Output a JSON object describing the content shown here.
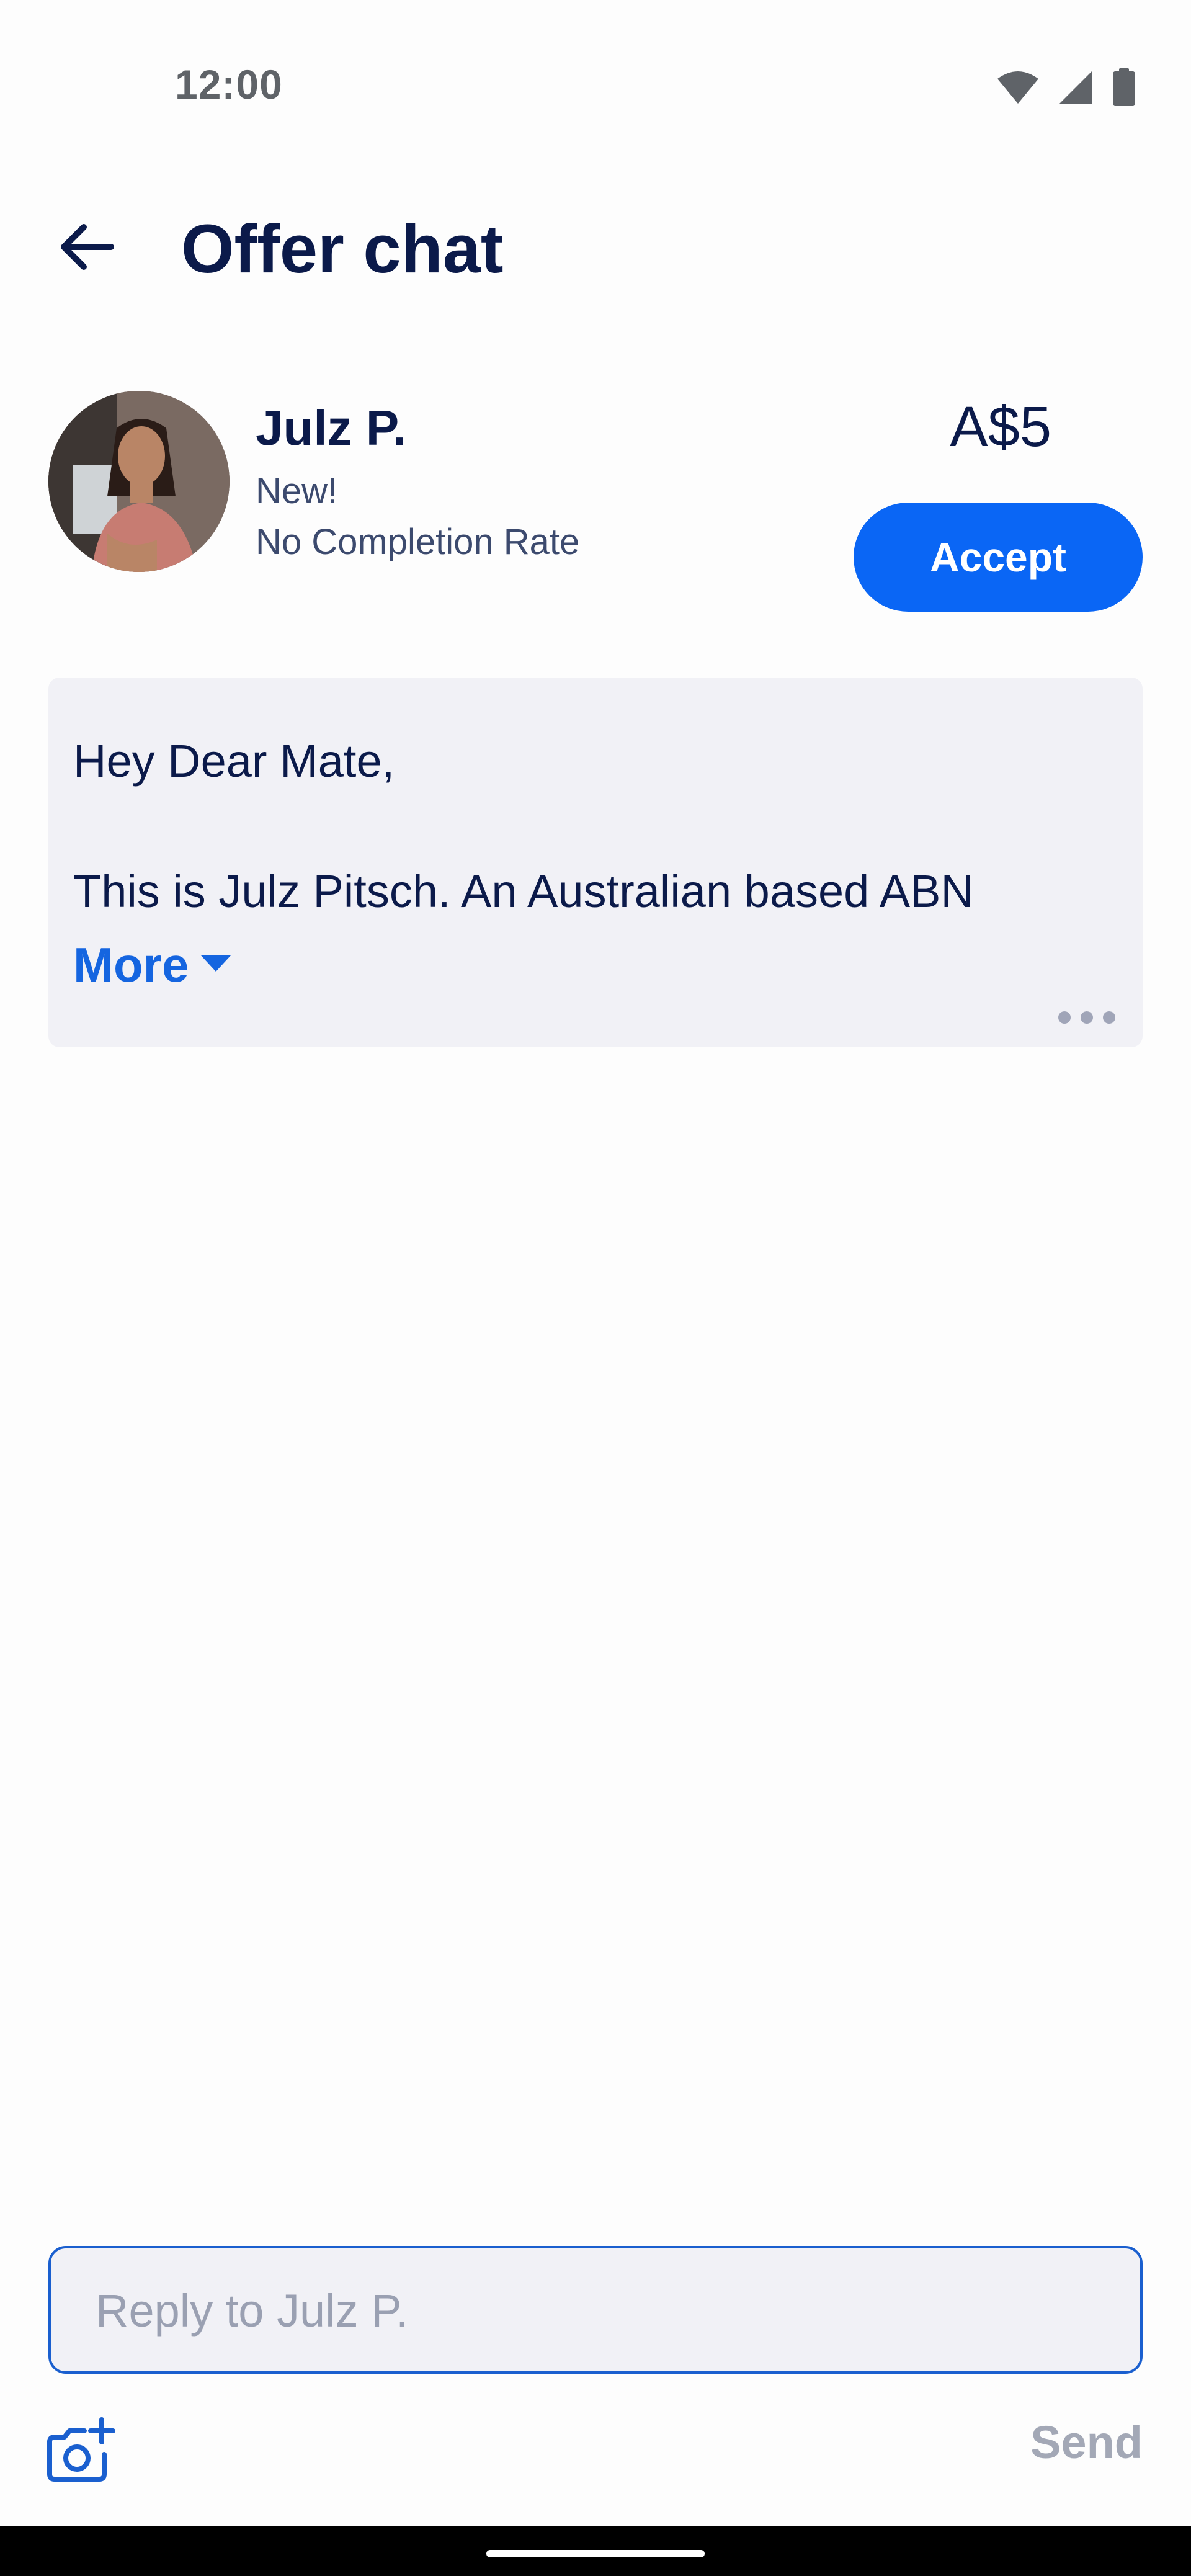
{
  "status_bar": {
    "time": "12:00",
    "icons": [
      "wifi-icon",
      "cellular-signal-icon",
      "battery-icon"
    ]
  },
  "app_bar": {
    "back_icon": "arrow-left-icon",
    "title": "Offer chat"
  },
  "offer": {
    "user_name": "Julz P.",
    "badge": "New!",
    "completion_rate": "No Completion Rate",
    "price": "A$5",
    "accept_label": "Accept"
  },
  "message": {
    "greeting": "Hey Dear Mate,",
    "body_preview": "This is Julz Pitsch. An Australian based ABN",
    "more_label": "More",
    "more_icon": "caret-down-icon",
    "options_icon": "more-horizontal-icon"
  },
  "reply": {
    "placeholder": "Reply to Julz P.",
    "value": "",
    "attach_icon": "add-photo-camera-icon",
    "send_label": "Send"
  },
  "colors": {
    "primary": "#0a66f5",
    "link": "#1565e0",
    "title_text": "#0b1a4a",
    "bubble_bg": "#f1f1f6",
    "disabled_text": "#a3a8b6"
  }
}
